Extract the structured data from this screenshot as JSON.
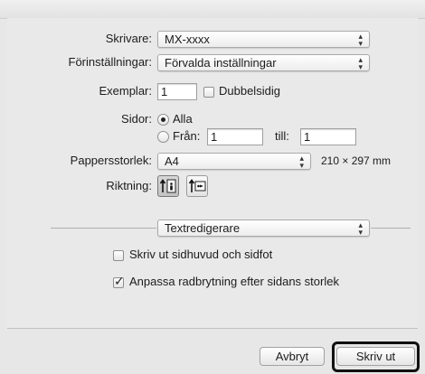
{
  "printer": {
    "label": "Skrivare:",
    "value": "MX-xxxx"
  },
  "presets": {
    "label": "Förinställningar:",
    "value": "Förvalda inställningar"
  },
  "copies": {
    "label": "Exemplar:",
    "value": "1",
    "duplex_label": "Dubbelsidig",
    "duplex_checked": false
  },
  "pages": {
    "label": "Sidor:",
    "all_label": "Alla",
    "from_label": "Från:",
    "from_value": "1",
    "to_label": "till:",
    "to_value": "1",
    "selected": "all"
  },
  "paper": {
    "label": "Pappersstorlek:",
    "value": "A4",
    "dimensions": "210 × 297 mm"
  },
  "orientation": {
    "label": "Riktning:",
    "selected": "portrait"
  },
  "section": {
    "value": "Textredigerare"
  },
  "options": {
    "header_footer_label": "Skriv ut sidhuvud och sidfot",
    "header_footer_checked": false,
    "rewrap_label": "Anpassa radbrytning efter sidans storlek",
    "rewrap_checked": true
  },
  "buttons": {
    "cancel_label": "Avbryt",
    "print_label": "Skriv ut"
  },
  "icons": {
    "popup_arrows": "up-down-arrows-icon",
    "portrait": "portrait-orientation-icon",
    "landscape": "landscape-orientation-icon"
  }
}
